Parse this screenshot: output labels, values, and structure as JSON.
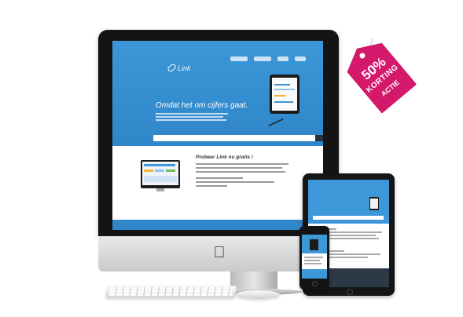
{
  "imac": {
    "site": {
      "logo": "Link",
      "hero_title": "Omdat het om cijfers gaat.",
      "section_title": "Probeer Link nu gratis !"
    }
  },
  "tag": {
    "discount": "50%",
    "label": "KORTING",
    "sublabel": "ACTIE"
  },
  "colors": {
    "brand_blue": "#3b97d8",
    "dark_navy": "#26333e",
    "tag_pink": "#d4186b"
  }
}
